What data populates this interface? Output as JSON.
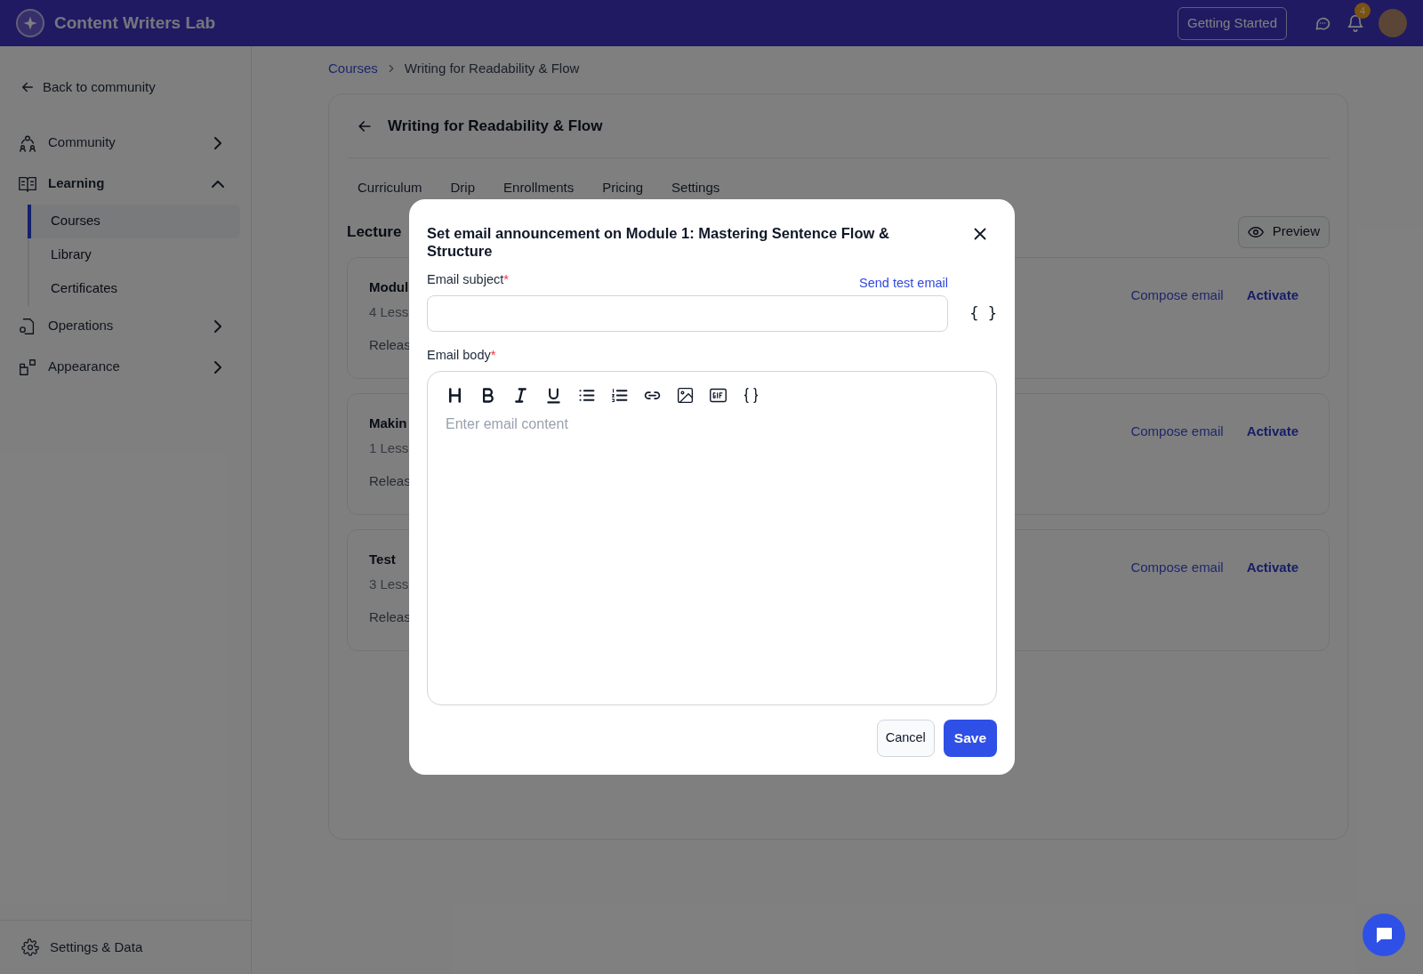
{
  "topbar": {
    "brand": "Content Writers Lab",
    "getting_started": "Getting Started",
    "notification_count": "4"
  },
  "sidebar": {
    "back": "Back to community",
    "items": [
      {
        "label": "Community",
        "expanded": false
      },
      {
        "label": "Learning",
        "expanded": true,
        "children": [
          {
            "label": "Courses",
            "selected": true
          },
          {
            "label": "Library",
            "selected": false
          },
          {
            "label": "Certificates",
            "selected": false
          }
        ]
      },
      {
        "label": "Operations",
        "expanded": false
      },
      {
        "label": "Appearance",
        "expanded": false
      }
    ],
    "footer": "Settings & Data"
  },
  "breadcrumb": [
    "Courses",
    "Writing for Readability & Flow"
  ],
  "course": {
    "title": "Writing for Readability & Flow",
    "tabs": [
      "Curriculum",
      "Drip",
      "Enrollments",
      "Pricing",
      "Settings"
    ],
    "section_title": "Lecture",
    "preview": "Preview",
    "modules": [
      {
        "title": "Modul",
        "lessons": "4 Less",
        "release": "Releas",
        "compose": "Compose email",
        "activate": "Activate"
      },
      {
        "title": "Makin",
        "lessons": "1 Less",
        "release": "Releas",
        "compose": "Compose email",
        "activate": "Activate"
      },
      {
        "title": "Test",
        "lessons": "3 Less",
        "release": "Releas",
        "compose": "Compose email",
        "activate": "Activate"
      }
    ]
  },
  "modal": {
    "title": "Set email announcement on Module 1: Mastering Sentence Flow & Structure",
    "subject_label": "Email subject",
    "required_mark": "*",
    "send_test": "Send test email",
    "variables": "{ }",
    "body_label": "Email body",
    "body_placeholder": "Enter email content",
    "cancel": "Cancel",
    "save": "Save"
  }
}
